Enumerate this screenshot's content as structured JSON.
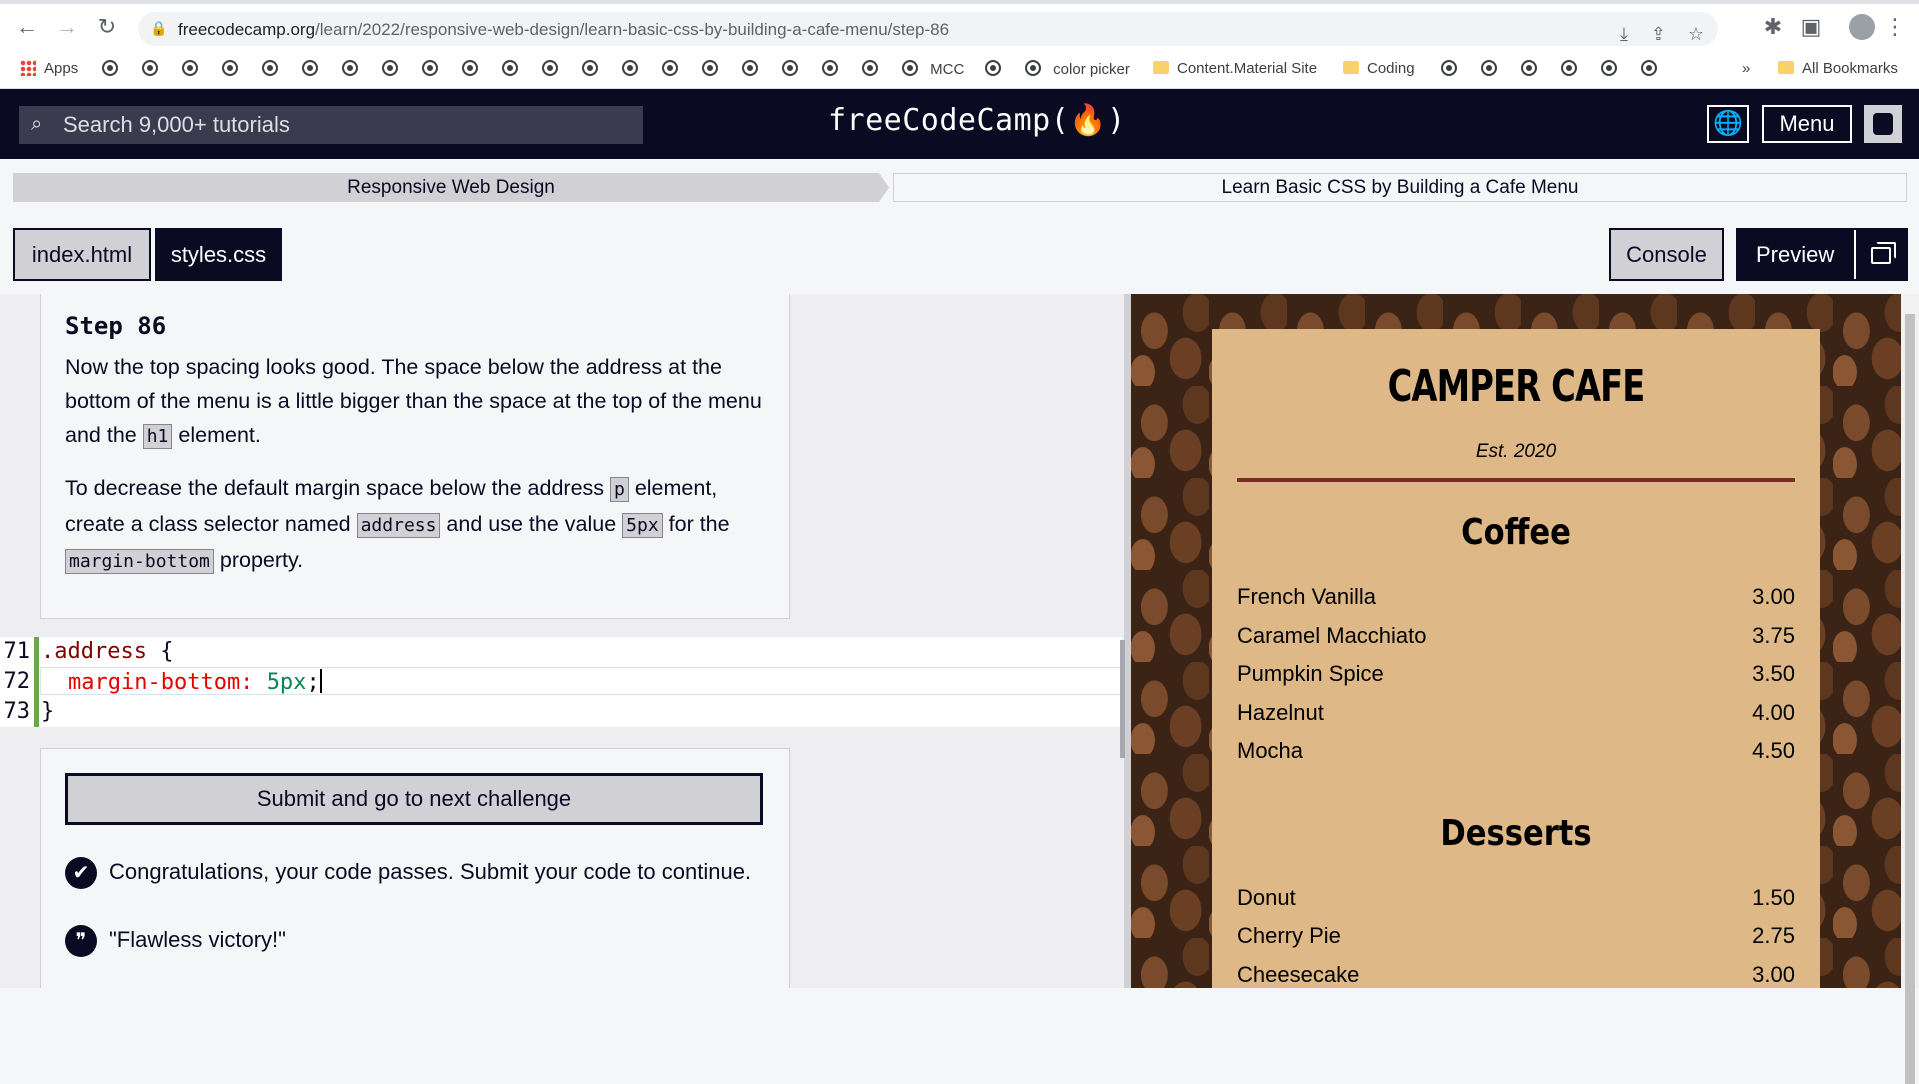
{
  "browser": {
    "url_host": "freecodecamp.org",
    "url_path": "/learn/2022/responsive-web-design/learn-basic-css-by-building-a-cafe-menu/step-86",
    "bookmarks": {
      "apps": "Apps",
      "mcc": "MCC",
      "color_picker": "color picker",
      "content_material": "Content.Material Site",
      "coding": "Coding",
      "all_bookmarks": "All Bookmarks",
      "overflow": "»"
    }
  },
  "header": {
    "search_placeholder": "Search 9,000+ tutorials",
    "logo": "freeCodeCamp(🔥)",
    "menu_label": "Menu"
  },
  "breadcrumb": {
    "superblock": "Responsive Web Design",
    "block": "Learn Basic CSS by Building a Cafe Menu"
  },
  "tabs": {
    "index": "index.html",
    "styles": "styles.css",
    "console": "Console",
    "preview": "Preview"
  },
  "description": {
    "title": "Step 86",
    "p1_a": "Now the top spacing looks good. The space below the address at the bottom of the menu is a little bigger than the space at the top of the menu and the ",
    "p1_code": "h1",
    "p1_b": " element.",
    "p2_a": "To decrease the default margin space below the address ",
    "p2_code1": "p",
    "p2_b": " element, create a class selector named ",
    "p2_code2": "address",
    "p2_c": " and use the value ",
    "p2_code3": "5px",
    "p2_d": " for the ",
    "p2_code4": "margin-bottom",
    "p2_e": " property."
  },
  "editor": {
    "lines": [
      {
        "num": "71",
        "selector": ".address",
        "brace": " {"
      },
      {
        "num": "72",
        "property": "margin-bottom:",
        "value": "5px",
        "semi": ";"
      },
      {
        "num": "73",
        "close": "}"
      }
    ]
  },
  "tests": {
    "submit_label": "Submit and go to next challenge",
    "pass_message": "Congratulations, your code passes. Submit your code to continue.",
    "quote": "\"Flawless victory!\""
  },
  "preview": {
    "title": "CAMPER CAFE",
    "est": "Est. 2020",
    "coffee_heading": "Coffee",
    "coffee": [
      {
        "name": "French Vanilla",
        "price": "3.00"
      },
      {
        "name": "Caramel Macchiato",
        "price": "3.75"
      },
      {
        "name": "Pumpkin Spice",
        "price": "3.50"
      },
      {
        "name": "Hazelnut",
        "price": "4.00"
      },
      {
        "name": "Mocha",
        "price": "4.50"
      }
    ],
    "desserts_heading": "Desserts",
    "desserts": [
      {
        "name": "Donut",
        "price": "1.50"
      },
      {
        "name": "Cherry Pie",
        "price": "2.75"
      },
      {
        "name": "Cheesecake",
        "price": "3.00"
      }
    ]
  }
}
